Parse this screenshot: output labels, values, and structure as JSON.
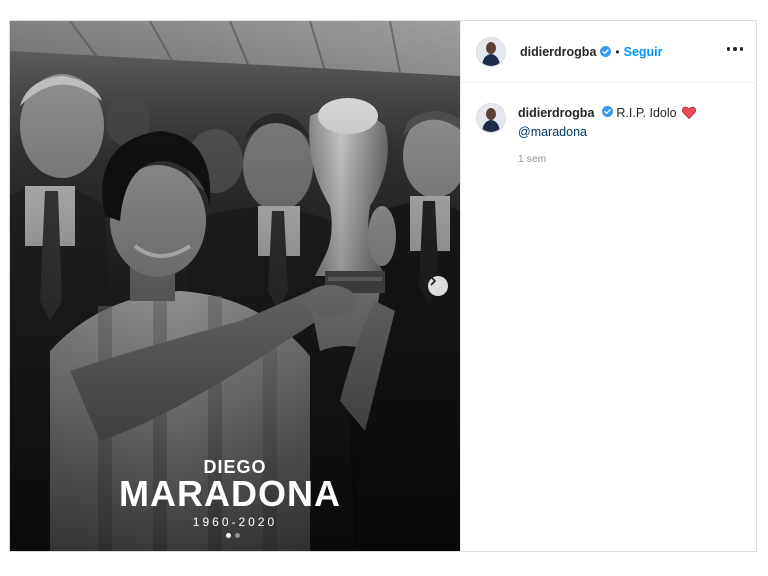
{
  "post": {
    "tribute_first_name": "DIEGO",
    "tribute_last_name": "MARADONA",
    "tribute_years": "1960-2020",
    "carousel_count": 2,
    "carousel_active_index": 0
  },
  "header": {
    "username": "didierdrogba",
    "verified": true,
    "separator": "•",
    "follow_label": "Seguir"
  },
  "caption": {
    "username": "didierdrogba",
    "text": "R.I.P. Idolo",
    "emoji": "red-heart-icon",
    "mention": "@maradona",
    "timestamp": "1 sem"
  },
  "colors": {
    "follow": "#0095f6",
    "verified_badge": "#3897f0",
    "mention": "#00376b",
    "heart": "#ed4956",
    "muted": "#8e8e8e"
  }
}
